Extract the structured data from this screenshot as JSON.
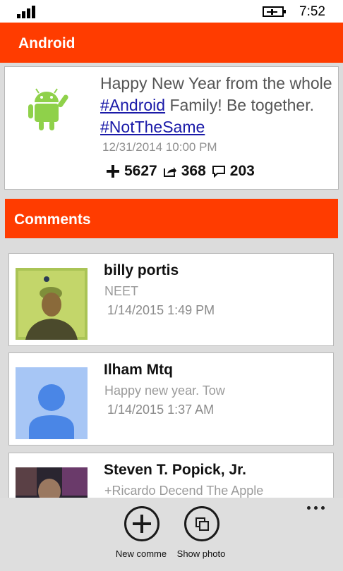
{
  "status_bar": {
    "time": "7:52"
  },
  "header": {
    "title": "Android"
  },
  "post": {
    "text_before": "Happy New Year from the whole ",
    "hashtag1": "#Android",
    "text_middle": " Family! Be together. ",
    "hashtag2": "#NotTheSame",
    "timestamp": "12/31/2014 10:00 PM",
    "plus_count": "5627",
    "share_count": "368",
    "comment_count": "203"
  },
  "comments_section": {
    "title": "Comments"
  },
  "comments": [
    {
      "author": "billy portis",
      "text": "NEET",
      "time": "1/14/2015 1:49 PM"
    },
    {
      "author": "Ilham Mtq",
      "text": "Happy new year. Tow",
      "time": "1/14/2015 1:37 AM"
    },
    {
      "author": "Steven T. Popick, Jr.",
      "text": "+Ricardo Decend The Apple",
      "time": ""
    }
  ],
  "app_bar": {
    "buttons": [
      {
        "label": "New comme",
        "icon": "add-icon"
      },
      {
        "label": "Show photo",
        "icon": "photo-icon"
      }
    ]
  }
}
